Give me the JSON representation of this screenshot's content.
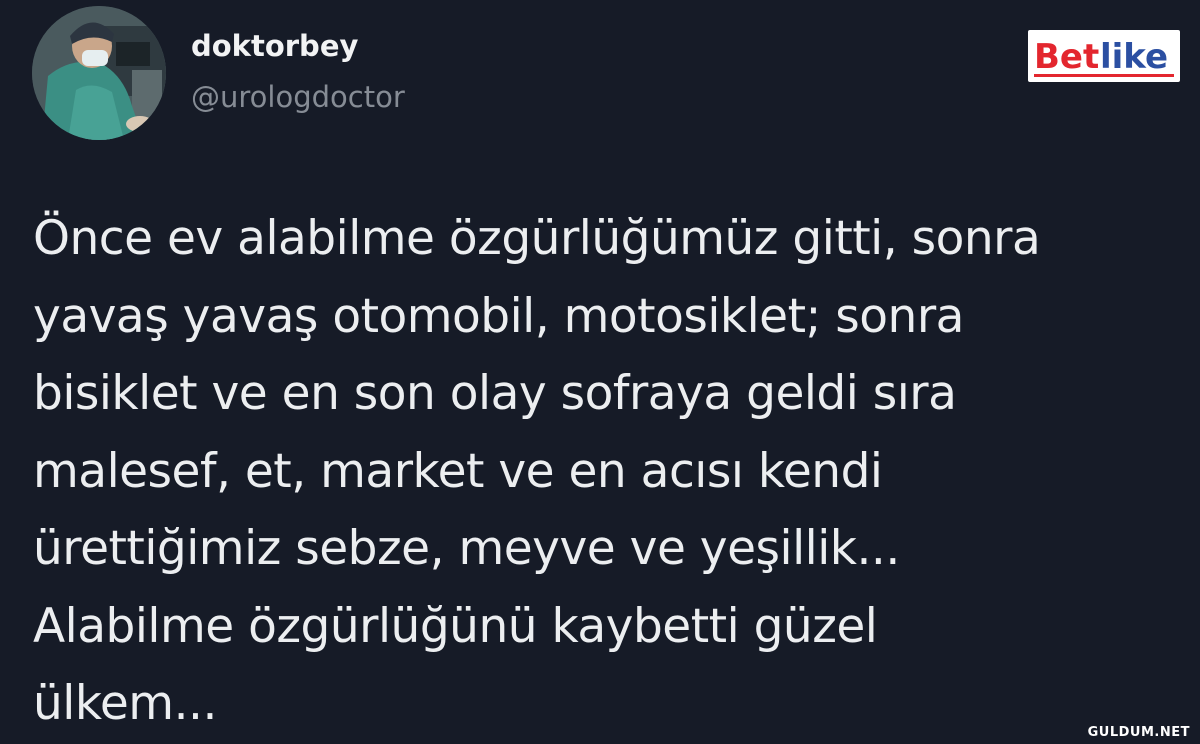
{
  "tweet": {
    "author": {
      "display_name": "doktorbey",
      "handle": "@urologdoctor",
      "avatar_icon": "surgeon-avatar"
    },
    "text_lines": [
      "Önce ev alabilme özgürlüğümüz gitti, sonra",
      "yavaş yavaş otomobil, motosiklet; sonra",
      "bisiklet ve en son olay sofraya geldi sıra",
      "malesef, et, market ve en acısı kendi",
      "ürettiğimiz sebze, meyve ve yeşillik...",
      "Alabilme özgürlüğünü kaybetti güzel",
      "ülkem..."
    ]
  },
  "brand": {
    "logo_text": "Betlike",
    "colors": {
      "red": "#e3262e",
      "blue": "#2b4fa2",
      "underline": "#e3262e"
    }
  },
  "watermark": {
    "text": "GULDUM.NET"
  },
  "theme": {
    "background": "#161b27",
    "text": "#eceef0",
    "muted": "#868c95"
  }
}
